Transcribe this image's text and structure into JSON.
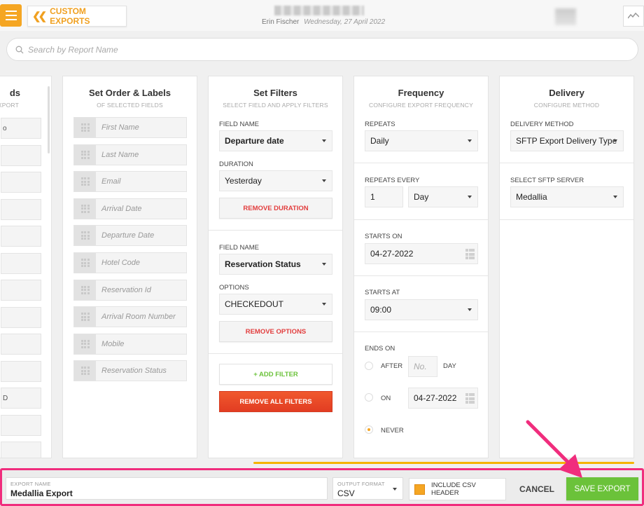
{
  "header": {
    "breadcrumb": "CUSTOM EXPORTS",
    "user": "Erin Fischer",
    "date": "Wednesday, 27 April 2022"
  },
  "search": {
    "placeholder": "Search by Report Name"
  },
  "fields_panel": {
    "title": "ds",
    "subtitle": "XPORT",
    "rows": [
      "o",
      "",
      "",
      "",
      "",
      "",
      "",
      "",
      "",
      "",
      "D",
      "",
      ""
    ]
  },
  "order_panel": {
    "title": "Set Order & Labels",
    "subtitle": "OF SELECTED FIELDS",
    "fields": [
      "First Name",
      "Last Name",
      "Email",
      "Arrival Date",
      "Departure Date",
      "Hotel Code",
      "Reservation Id",
      "Arrival Room Number",
      "Mobile",
      "Reservation Status"
    ]
  },
  "filters_panel": {
    "title": "Set Filters",
    "subtitle": "SELECT FIELD AND APPLY FILTERS",
    "filter1": {
      "field_label": "FIELD NAME",
      "field_value": "Departure date",
      "duration_label": "DURATION",
      "duration_value": "Yesterday",
      "remove_label": "REMOVE DURATION"
    },
    "filter2": {
      "field_label": "FIELD NAME",
      "field_value": "Reservation Status",
      "options_label": "OPTIONS",
      "options_value": "CHECKEDOUT",
      "remove_label": "REMOVE OPTIONS"
    },
    "add_filter": "+ ADD FILTER",
    "remove_all": "REMOVE ALL FILTERS"
  },
  "frequency_panel": {
    "title": "Frequency",
    "subtitle": "CONFIGURE EXPORT FREQUENCY",
    "repeats_label": "REPEATS",
    "repeats_value": "Daily",
    "repeats_every_label": "REPEATS EVERY",
    "repeats_every_number": "1",
    "repeats_every_unit": "Day",
    "starts_on_label": "STARTS ON",
    "starts_on_value": "04-27-2022",
    "starts_at_label": "STARTS AT",
    "starts_at_value": "09:00",
    "ends_on_label": "ENDS ON",
    "after_label": "AFTER",
    "after_placeholder": "No.",
    "after_unit": "DAY",
    "on_label": "ON",
    "on_value": "04-27-2022",
    "never_label": "NEVER",
    "ends_selected": "never"
  },
  "delivery_panel": {
    "title": "Delivery",
    "subtitle": "CONFIGURE METHOD",
    "method_label": "DELIVERY METHOD",
    "method_value": "SFTP Export Delivery Type",
    "server_label": "SELECT SFTP SERVER",
    "server_value": "Medallia"
  },
  "footer": {
    "export_name_label": "EXPORT NAME",
    "export_name_value": "Medallia Export",
    "output_format_label": "OUTPUT FORMAT",
    "output_format_value": "CSV",
    "csv_header_label": "INCLUDE CSV HEADER",
    "csv_header_checked": true,
    "cancel_label": "CANCEL",
    "save_label": "SAVE EXPORT"
  },
  "colors": {
    "accent": "#f5a623",
    "danger": "#e23d3d",
    "save": "#6bc23a",
    "highlight": "#f02d7d"
  }
}
